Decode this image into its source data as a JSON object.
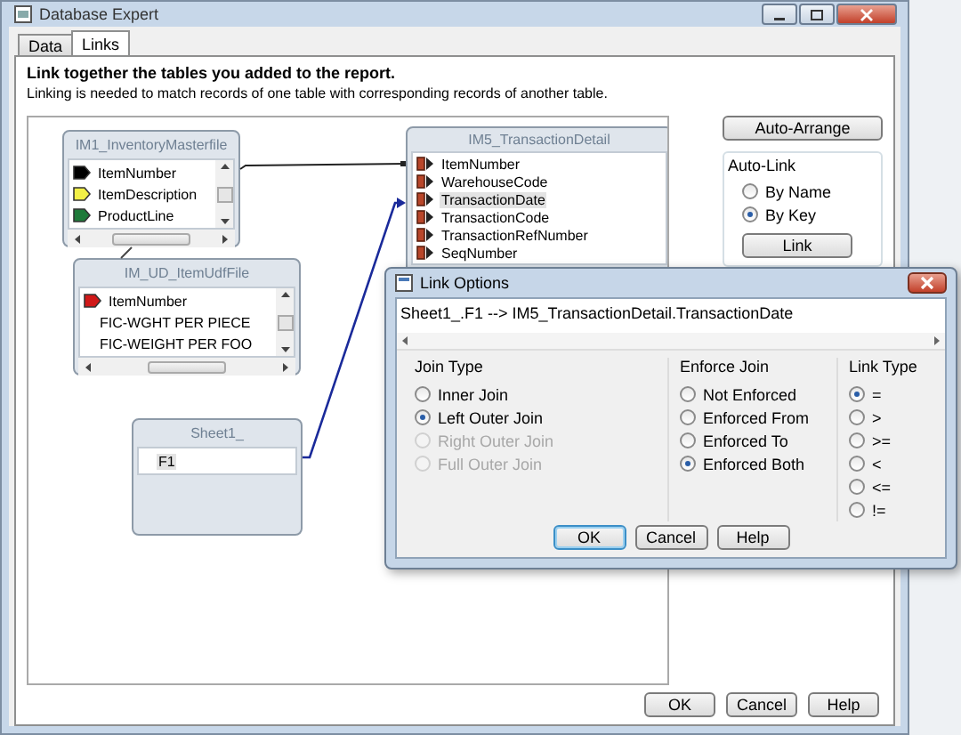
{
  "window": {
    "title": "Database Expert"
  },
  "tabs": [
    {
      "label": "Data",
      "selected": false
    },
    {
      "label": "Links",
      "selected": true
    }
  ],
  "heading": "Link together the tables you added to the report.",
  "description": "Linking is needed to match records of one table with corresponding records of another table.",
  "tables": [
    {
      "title": "IM1_InventoryMasterfile",
      "fields": [
        {
          "name": "ItemNumber",
          "kind": "tag",
          "color": "#000000",
          "selected": false
        },
        {
          "name": "ItemDescription",
          "kind": "tag",
          "color": "#f2f046",
          "selected": false
        },
        {
          "name": "ProductLine",
          "kind": "tag",
          "color": "#1f7a3a",
          "selected": false
        }
      ]
    },
    {
      "title": "IM_UD_ItemUdfFile",
      "fields": [
        {
          "name": "ItemNumber",
          "kind": "tag",
          "color": "#d01818",
          "selected": false
        },
        {
          "name": "FIC-WGHT PER PIECE",
          "kind": "plain",
          "selected": false
        },
        {
          "name": "FIC-WEIGHT PER FOO",
          "kind": "plain",
          "selected": false
        }
      ]
    },
    {
      "title": "Sheet1_",
      "fields": [
        {
          "name": "F1",
          "kind": "plain",
          "selected": true
        }
      ]
    },
    {
      "title": "IM5_TransactionDetail",
      "fields": [
        {
          "name": "ItemNumber",
          "kind": "key",
          "selected": false
        },
        {
          "name": "WarehouseCode",
          "kind": "key",
          "selected": false
        },
        {
          "name": "TransactionDate",
          "kind": "key",
          "selected": true
        },
        {
          "name": "TransactionCode",
          "kind": "key",
          "selected": false
        },
        {
          "name": "TransactionRefNumber",
          "kind": "key",
          "selected": false
        },
        {
          "name": "SeqNumber",
          "kind": "key",
          "selected": false
        }
      ]
    }
  ],
  "side": {
    "auto_arrange": "Auto-Arrange",
    "auto_link": {
      "label": "Auto-Link",
      "options": [
        {
          "label": "By Name",
          "selected": false
        },
        {
          "label": "By Key",
          "selected": true
        }
      ],
      "button": "Link"
    }
  },
  "footer_buttons": [
    "OK",
    "Cancel",
    "Help"
  ],
  "link_options": {
    "title": "Link Options",
    "path": "Sheet1_.F1 --> IM5_TransactionDetail.TransactionDate",
    "groups": [
      {
        "label": "Join Type",
        "options": [
          {
            "label": "Inner Join",
            "selected": false,
            "disabled": false
          },
          {
            "label": "Left Outer Join",
            "selected": true,
            "disabled": false
          },
          {
            "label": "Right Outer Join",
            "selected": false,
            "disabled": true
          },
          {
            "label": "Full Outer Join",
            "selected": false,
            "disabled": true
          }
        ]
      },
      {
        "label": "Enforce Join",
        "options": [
          {
            "label": "Not Enforced",
            "selected": false,
            "disabled": false
          },
          {
            "label": "Enforced From",
            "selected": false,
            "disabled": false
          },
          {
            "label": "Enforced To",
            "selected": false,
            "disabled": false
          },
          {
            "label": "Enforced Both",
            "selected": true,
            "disabled": false
          }
        ]
      },
      {
        "label": "Link Type",
        "options": [
          {
            "label": "=",
            "selected": true,
            "disabled": false
          },
          {
            "label": ">",
            "selected": false,
            "disabled": false
          },
          {
            "label": ">=",
            "selected": false,
            "disabled": false
          },
          {
            "label": "<",
            "selected": false,
            "disabled": false
          },
          {
            "label": "<=",
            "selected": false,
            "disabled": false
          },
          {
            "label": "!=",
            "selected": false,
            "disabled": false
          }
        ]
      }
    ],
    "buttons": [
      "OK",
      "Cancel",
      "Help"
    ]
  }
}
